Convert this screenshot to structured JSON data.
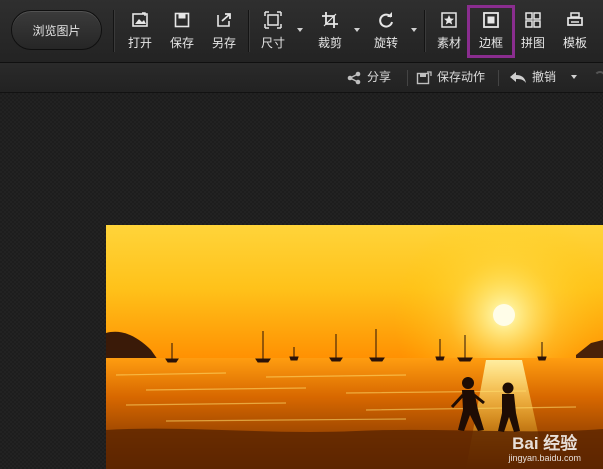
{
  "toolbar": {
    "browse_label": "浏览图片",
    "open_label": "打开",
    "save_label": "保存",
    "save_as_label": "另存",
    "size_label": "尺寸",
    "crop_label": "裁剪",
    "rotate_label": "旋转",
    "material_label": "素材",
    "border_label": "边框",
    "collage_label": "拼图",
    "template_label": "模板",
    "highlight_color": "#8a2d8f"
  },
  "subbar": {
    "share_label": "分享",
    "save_action_label": "保存动作",
    "undo_label": "撤销"
  },
  "canvas": {
    "watermark_main": "Bai 经验",
    "watermark_sub": "jingyan.baidu.com"
  },
  "colors": {
    "toolbar_bg": "#2a2a2a",
    "canvas_bg": "#1d1d1d",
    "sky_top": "#ffe23a",
    "sky_horizon": "#ff8a00",
    "sea": "#c85a00"
  }
}
